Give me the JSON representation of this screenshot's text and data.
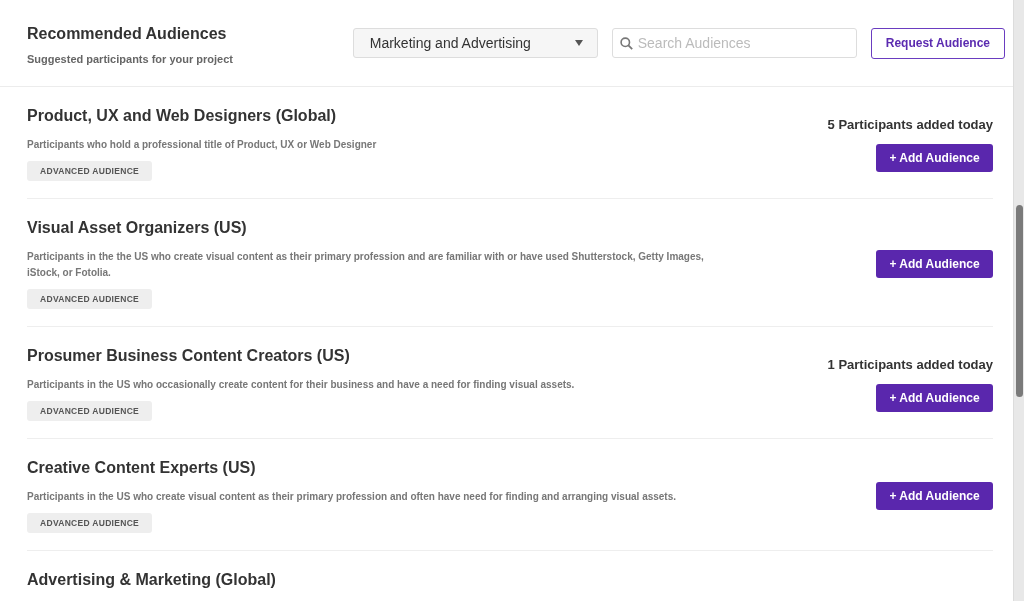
{
  "header": {
    "title": "Recommended Audiences",
    "subtitle": "Suggested participants for your project",
    "category_select": {
      "value": "Marketing and Advertising"
    },
    "search": {
      "placeholder": "Search Audiences"
    },
    "request_button": "Request Audience"
  },
  "audiences": [
    {
      "title": "Product, UX and Web Designers (Global)",
      "description": "Participants who hold a professional title of Product, UX or Web Designer",
      "tag": "ADVANCED AUDIENCE",
      "added_today": "5 Participants added today",
      "button": "+ Add Audience"
    },
    {
      "title": "Visual Asset Organizers (US)",
      "description": "Participants in the the US who create visual content as their primary profession and are familiar with or have used Shutterstock, Getty Images, iStock, or Fotolia.",
      "tag": "ADVANCED AUDIENCE",
      "button": "+ Add Audience"
    },
    {
      "title": "Prosumer Business Content Creators (US)",
      "description": "Participants in the US who occasionally create content for their business and have a need for finding visual assets.",
      "tag": "ADVANCED AUDIENCE",
      "added_today": "1 Participants added today",
      "button": "+ Add Audience"
    },
    {
      "title": "Creative Content Experts (US)",
      "description": "Participants in the US who create visual content as their primary profession and often have need for finding and arranging visual assets.",
      "tag": "ADVANCED AUDIENCE",
      "button": "+ Add Audience"
    },
    {
      "title": "Advertising & Marketing (Global)"
    }
  ]
}
